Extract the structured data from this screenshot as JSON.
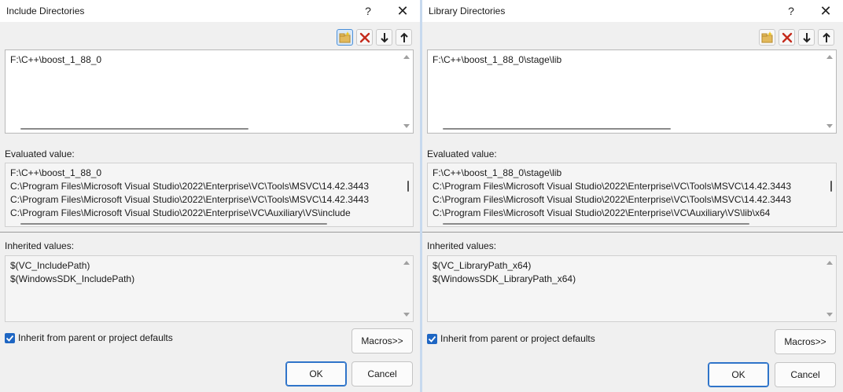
{
  "left": {
    "title": "Include Directories",
    "help": "?",
    "close": "✕",
    "edit_lines": [
      "F:\\C++\\boost_1_88_0"
    ],
    "evaluated_label": "Evaluated value:",
    "evaluated_lines": [
      "F:\\C++\\boost_1_88_0",
      "C:\\Program Files\\Microsoft Visual Studio\\2022\\Enterprise\\VC\\Tools\\MSVC\\14.42.3443",
      "C:\\Program Files\\Microsoft Visual Studio\\2022\\Enterprise\\VC\\Tools\\MSVC\\14.42.3443",
      "C:\\Program Files\\Microsoft Visual Studio\\2022\\Enterprise\\VC\\Auxiliary\\VS\\include"
    ],
    "inherited_label": "Inherited values:",
    "inherited_lines": [
      "$(VC_IncludePath)",
      "$(WindowsSDK_IncludePath)"
    ],
    "inherit_checkbox_label": "Inherit from parent or project defaults",
    "inherit_checked": true,
    "macros_label": "Macros>>",
    "ok_label": "OK",
    "cancel_label": "Cancel"
  },
  "right": {
    "title": "Library Directories",
    "help": "?",
    "close": "✕",
    "edit_lines": [
      "F:\\C++\\boost_1_88_0\\stage\\lib"
    ],
    "evaluated_label": "Evaluated value:",
    "evaluated_lines": [
      "F:\\C++\\boost_1_88_0\\stage\\lib",
      "C:\\Program Files\\Microsoft Visual Studio\\2022\\Enterprise\\VC\\Tools\\MSVC\\14.42.3443",
      "C:\\Program Files\\Microsoft Visual Studio\\2022\\Enterprise\\VC\\Tools\\MSVC\\14.42.3443",
      "C:\\Program Files\\Microsoft Visual Studio\\2022\\Enterprise\\VC\\Auxiliary\\VS\\lib\\x64"
    ],
    "inherited_label": "Inherited values:",
    "inherited_lines": [
      "$(VC_LibraryPath_x64)",
      "$(WindowsSDK_LibraryPath_x64)"
    ],
    "inherit_checkbox_label": "Inherit from parent or project defaults",
    "inherit_checked": true,
    "macros_label": "Macros>>",
    "ok_label": "OK",
    "cancel_label": "Cancel"
  },
  "colors": {
    "accent": "#1e66c3",
    "delete_red": "#c42b1c",
    "window_bg": "#f0f0f0"
  },
  "icons": {
    "new_line": "new-folder-icon",
    "delete": "delete-x-icon",
    "move_down": "arrow-down-icon",
    "move_up": "arrow-up-icon"
  }
}
